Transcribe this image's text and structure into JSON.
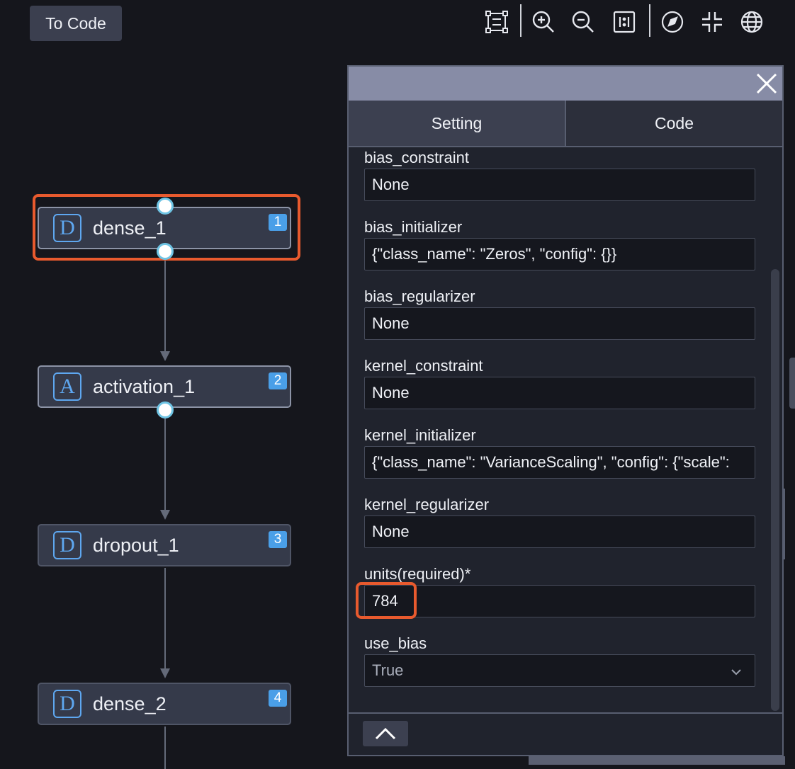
{
  "toolbar": {
    "to_code_label": "To Code",
    "icons": [
      "fit-view-icon",
      "zoom-in-icon",
      "zoom-out-icon",
      "layout-icon",
      "navigate-icon",
      "collapse-icon",
      "globe-icon"
    ]
  },
  "graph": {
    "nodes": [
      {
        "icon_letter": "D",
        "label": "dense_1",
        "index": "1",
        "selected": true
      },
      {
        "icon_letter": "A",
        "label": "activation_1",
        "index": "2",
        "selected": false
      },
      {
        "icon_letter": "D",
        "label": "dropout_1",
        "index": "3",
        "selected": false
      },
      {
        "icon_letter": "D",
        "label": "dense_2",
        "index": "4",
        "selected": false
      }
    ]
  },
  "panel": {
    "tabs": [
      {
        "label": "Setting",
        "active": true
      },
      {
        "label": "Code",
        "active": false
      }
    ],
    "fields": [
      {
        "label": "bias_constraint",
        "value": "None"
      },
      {
        "label": "bias_initializer",
        "value": "{\"class_name\": \"Zeros\", \"config\": {}}"
      },
      {
        "label": "bias_regularizer",
        "value": "None"
      },
      {
        "label": "kernel_constraint",
        "value": "None"
      },
      {
        "label": "kernel_initializer",
        "value": "{\"class_name\": \"VarianceScaling\", \"config\": {\"scale\":"
      },
      {
        "label": "kernel_regularizer",
        "value": "None"
      },
      {
        "label": "units(required)*",
        "value": "784"
      },
      {
        "label": "use_bias",
        "value": "True",
        "type": "select"
      }
    ]
  },
  "colors": {
    "highlight": "#e85a2e",
    "accent": "#4a9fe8",
    "port": "#6ec4e4"
  }
}
